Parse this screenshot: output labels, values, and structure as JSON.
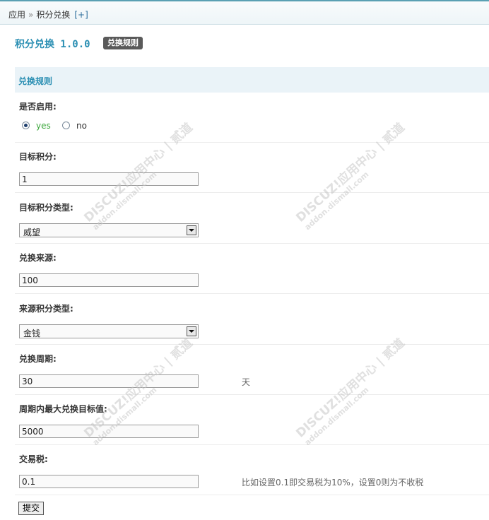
{
  "breadcrumb": {
    "root": "应用",
    "sep": "»",
    "current": "积分兑换",
    "add": "[+]"
  },
  "plugin": {
    "title": "积分兑换 1.0.0",
    "tab": "兑换规则"
  },
  "section": {
    "heading": "兑换规则"
  },
  "form": {
    "enabled": {
      "label": "是否启用:",
      "yes": "yes",
      "no": "no",
      "selected": "yes"
    },
    "target_credit": {
      "label": "目标积分:",
      "value": "1"
    },
    "target_credit_type": {
      "label": "目标积分类型:",
      "value": "威望"
    },
    "exchange_source": {
      "label": "兑换来源:",
      "value": "100"
    },
    "source_credit_type": {
      "label": "来源积分类型:",
      "value": "金钱"
    },
    "exchange_period": {
      "label": "兑换周期:",
      "value": "30",
      "unit": "天"
    },
    "max_per_period": {
      "label": "周期内最大兑换目标值:",
      "value": "5000"
    },
    "tax": {
      "label": "交易税:",
      "value": "0.1",
      "hint": "比如设置0.1即交易税为10%，设置0则为不收税"
    },
    "submit": "提交"
  },
  "watermark": {
    "brand": "DISCUZ!应用中心 | 贰道",
    "url": "addon.dismall.com"
  },
  "colors": {
    "accent": "#2b8fb3",
    "section_bg": "#eaf3f8",
    "yes_text": "#3aa63a"
  }
}
